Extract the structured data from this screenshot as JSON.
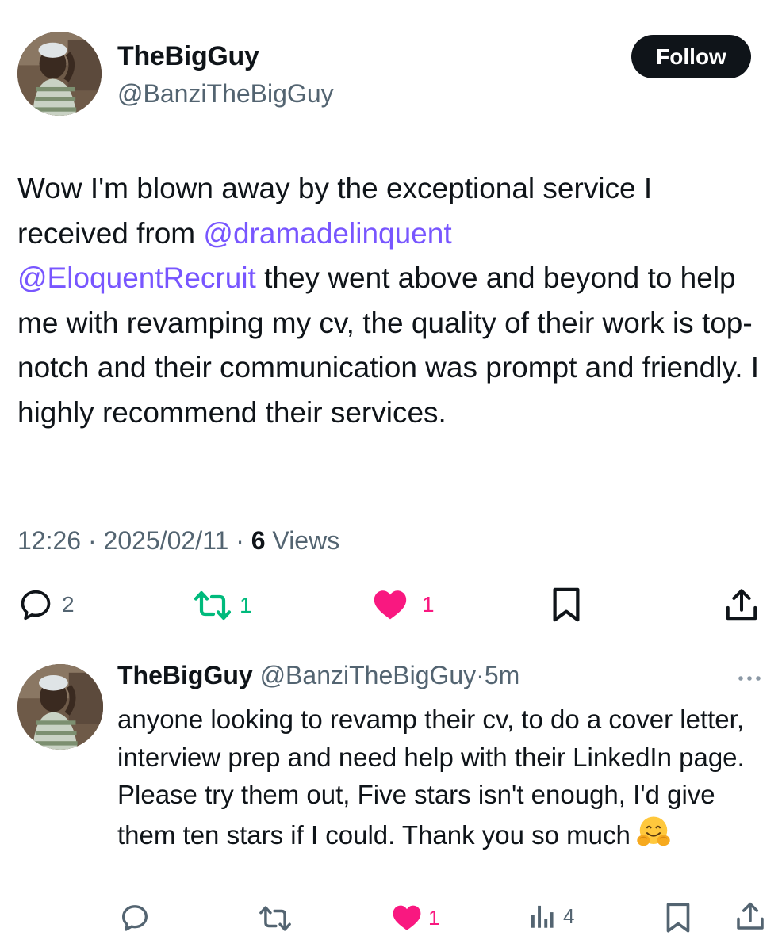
{
  "main_tweet": {
    "author_name": "TheBigGuy",
    "author_handle": "@BanziTheBigGuy",
    "follow_label": "Follow",
    "text_part1": "Wow I'm blown away by the exceptional service I received from ",
    "mention1": "@dramadelinquent",
    "text_part2": " ",
    "mention2": "@EloquentRecruit",
    "text_part3": " they went above and beyond to help me with revamping my cv, the quality of their work is top-notch and their communication was prompt and friendly. I highly recommend their services.",
    "time": "12:26",
    "date": "2025/02/11",
    "separator": "·",
    "views_count": "6",
    "views_label": "Views",
    "reply_count": "2",
    "retweet_count": "1",
    "like_count": "1"
  },
  "reply": {
    "author_name": "TheBigGuy",
    "author_handle": "@BanziTheBigGuy",
    "separator": "·",
    "time_ago": "5m",
    "text": "anyone looking to revamp their cv, to do a cover letter, interview prep and need help with their LinkedIn page. Please try them out, Five stars isn't enough, I'd give them ten stars if I could. Thank you so much",
    "emoji": "hugging-face-emoji",
    "like_count": "1",
    "views_count": "4"
  },
  "icons": {
    "reply": "reply-icon",
    "retweet": "retweet-icon",
    "like": "heart-icon",
    "bookmark": "bookmark-icon",
    "share": "share-icon",
    "views": "views-icon",
    "more": "more-icon"
  },
  "colors": {
    "accent_mention": "#7856ff",
    "retweet_green": "#00ba7c",
    "like_pink": "#f91880",
    "secondary_text": "#536471",
    "primary_text": "#0f1419",
    "follow_button_bg": "#0f1419"
  }
}
